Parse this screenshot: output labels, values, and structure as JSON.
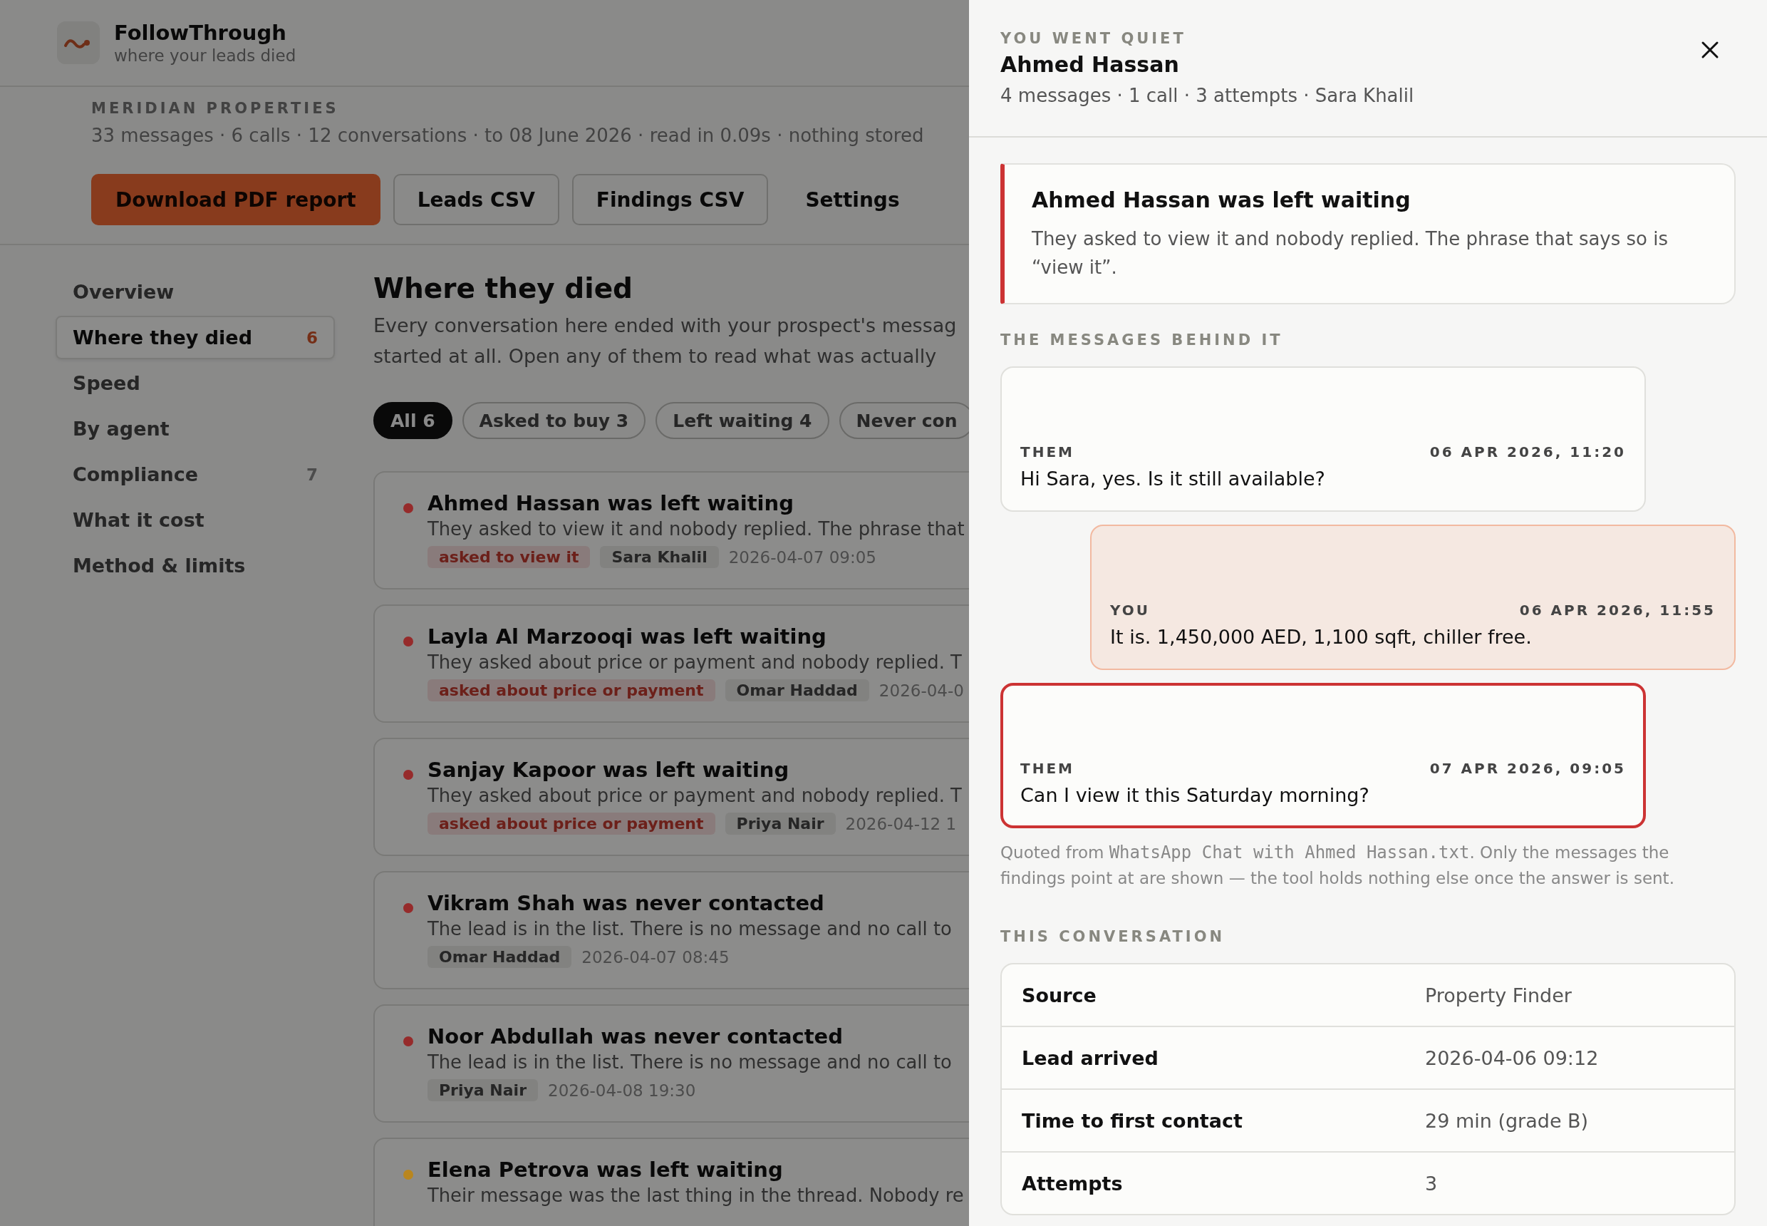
{
  "app": {
    "name": "FollowThrough",
    "tagline": "where your leads died"
  },
  "account": {
    "name": "MERIDIAN PROPERTIES",
    "summary": "33 messages · 6 calls · 12 conversations · to 08 June 2026 · read in 0.09s · nothing stored"
  },
  "actions": [
    {
      "label": "Download PDF report",
      "kind": "primary"
    },
    {
      "label": "Leads CSV",
      "kind": "outline"
    },
    {
      "label": "Findings CSV",
      "kind": "outline"
    },
    {
      "label": "Settings",
      "kind": "plain"
    }
  ],
  "sidebar": {
    "items": [
      {
        "label": "Overview",
        "selected": false
      },
      {
        "label": "Where they died",
        "selected": true,
        "count": "6"
      },
      {
        "label": "Speed",
        "selected": false
      },
      {
        "label": "By agent",
        "selected": false
      },
      {
        "label": "Compliance",
        "selected": false,
        "count": "7"
      },
      {
        "label": "What it cost",
        "selected": false
      },
      {
        "label": "Method & limits",
        "selected": false
      }
    ]
  },
  "main": {
    "title": "Where they died",
    "description_lines": [
      "Every conversation here ended with your prospect's messag",
      "started at all. Open any of them to read what was actually"
    ],
    "filters": [
      {
        "label": "All 6",
        "selected": true
      },
      {
        "label": "Asked to buy 3",
        "selected": false
      },
      {
        "label": "Left waiting 4",
        "selected": false
      },
      {
        "label": "Never con",
        "selected": false
      }
    ],
    "cards": [
      {
        "title": "Ahmed Hassan was left waiting",
        "color": "#962b2b",
        "body": "They asked to view it and nobody replied. The phrase that",
        "tags": [
          {
            "text": "asked to view it",
            "kind": "finding"
          },
          {
            "text": "Sara Khalil",
            "kind": "agent"
          }
        ],
        "date": "2026-04-07 09:05"
      },
      {
        "title": "Layla Al Marzooqi was left waiting",
        "color": "#962b2b",
        "body": "They asked about price or payment and nobody replied. T",
        "tags": [
          {
            "text": "asked about price or payment",
            "kind": "finding"
          },
          {
            "text": "Omar Haddad",
            "kind": "agent"
          }
        ],
        "date": "2026-04-0"
      },
      {
        "title": "Sanjay Kapoor was left waiting",
        "color": "#962b2b",
        "body": "They asked about price or payment and nobody replied. T",
        "tags": [
          {
            "text": "asked about price or payment",
            "kind": "finding"
          },
          {
            "text": "Priya Nair",
            "kind": "agent"
          }
        ],
        "date": "2026-04-12 1"
      },
      {
        "title": "Vikram Shah was never contacted",
        "color": "#962b2b",
        "body": "The lead is in the list. There is no message and no call to",
        "tags": [
          {
            "text": "Omar Haddad",
            "kind": "agent"
          }
        ],
        "date": "2026-04-07 08:45"
      },
      {
        "title": "Noor Abdullah was never contacted",
        "color": "#962b2b",
        "body": "The lead is in the list. There is no message and no call to",
        "tags": [
          {
            "text": "Priya Nair",
            "kind": "agent"
          }
        ],
        "date": "2026-04-08 19:30"
      },
      {
        "title": "Elena Petrova was left waiting",
        "color": "#b9861e",
        "body": "Their message was the last thing in the thread. Nobody re"
      }
    ]
  },
  "drawer": {
    "kicker": "YOU WENT QUIET",
    "title": "Ahmed Hassan",
    "meta": "4 messages · 1 call · 3 attempts · Sara Khalil",
    "finding": {
      "title": "Ahmed Hassan was left waiting",
      "text": "They asked to view it and nobody replied. The phrase that says so is “view it”."
    },
    "messages_heading": "THE MESSAGES BEHIND IT",
    "messages": [
      {
        "kind": "them",
        "sender": "THEM",
        "time": "06 APR 2026, 11:20",
        "text": "Hi Sara, yes. Is it still available?",
        "highlighted": false
      },
      {
        "kind": "you",
        "sender": "YOU",
        "time": "06 APR 2026, 11:55",
        "text": "It is. 1,450,000 AED, 1,100 sqft, chiller free.",
        "highlighted": false
      },
      {
        "kind": "them",
        "sender": "THEM",
        "time": "07 APR 2026, 09:05",
        "text": "Can I view it this Saturday morning?",
        "highlighted": true
      }
    ],
    "footnote": {
      "before": "Quoted from ",
      "file": "WhatsApp Chat with Ahmed Hassan.txt",
      "after": ". Only the messages the findings point at are shown — the tool holds nothing else once the answer is sent."
    },
    "conversation_heading": "THIS CONVERSATION",
    "details": [
      {
        "label": "Source",
        "value": "Property Finder"
      },
      {
        "label": "Lead arrived",
        "value": "2026-04-06 09:12"
      },
      {
        "label": "Time to first contact",
        "value": "29 min (grade B)"
      },
      {
        "label": "Attempts",
        "value": "3"
      }
    ]
  }
}
